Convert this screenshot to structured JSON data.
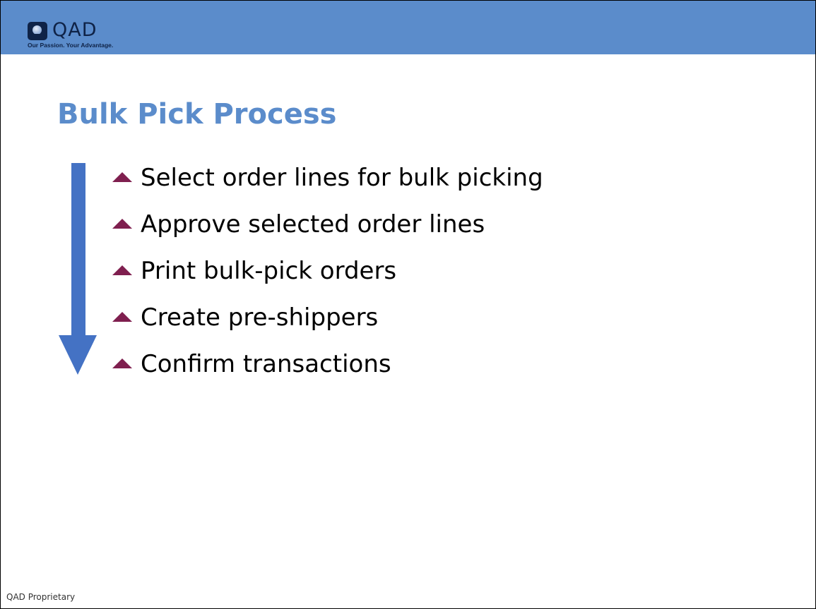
{
  "header": {
    "logo_text": "QAD",
    "logo_tagline": "Our Passion. Your Advantage."
  },
  "colors": {
    "header_bar": "#5b8ccb",
    "title": "#5b8ccb",
    "arrow": "#4472c4",
    "bullet_marker": "#7f1f4f"
  },
  "slide": {
    "title": "Bulk Pick Process",
    "bullets": [
      "Select order lines for bulk picking",
      "Approve selected order lines",
      "Print bulk-pick orders",
      "Create pre-shippers",
      "Confirm transactions"
    ]
  },
  "footer": {
    "text": "QAD Proprietary"
  }
}
